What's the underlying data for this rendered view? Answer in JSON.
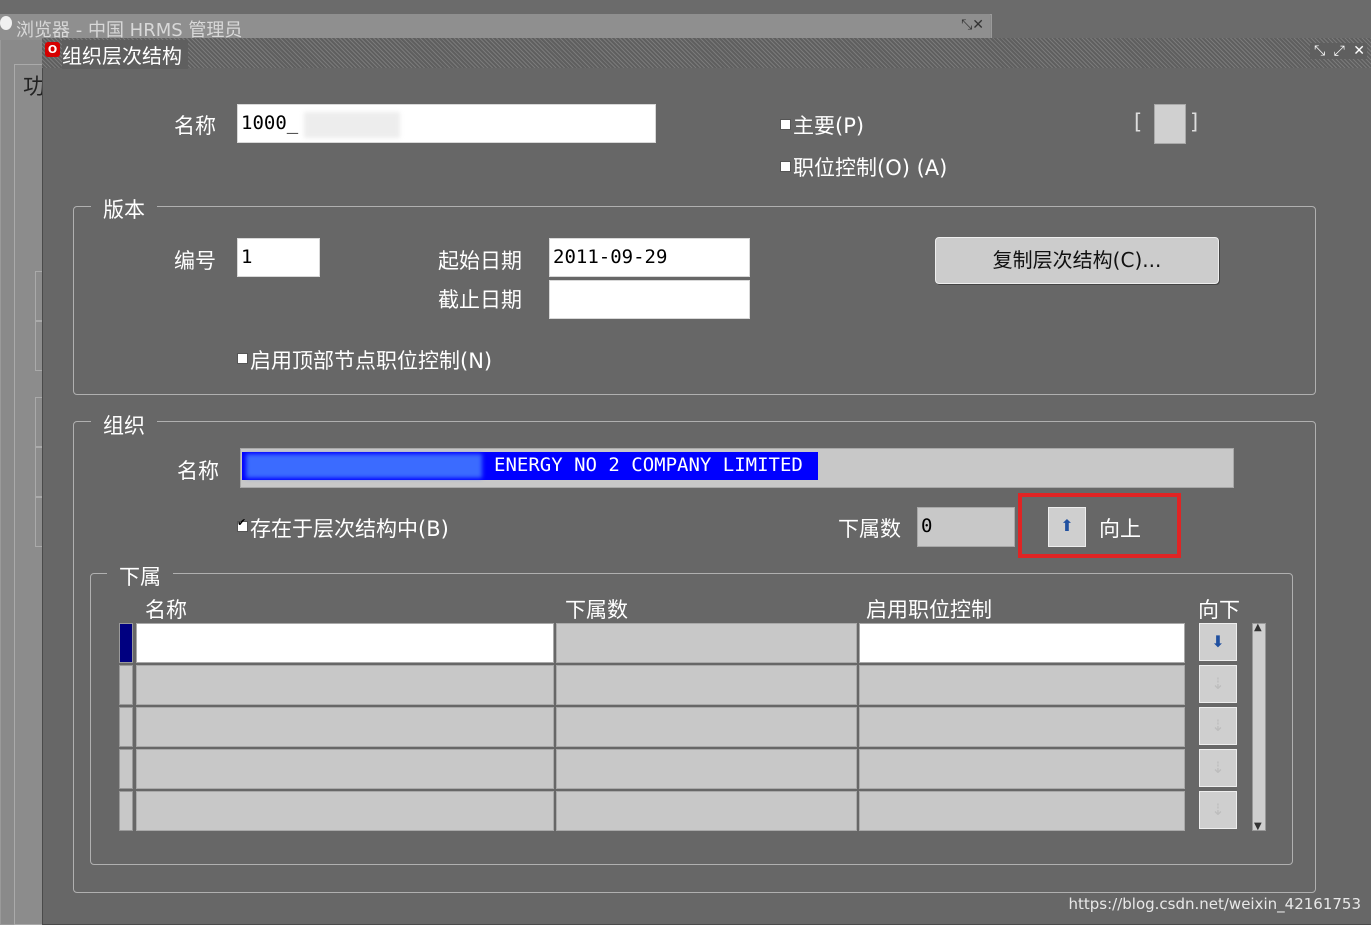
{
  "background_window": {
    "title": "浏览器 - 中国 HRMS 管理员",
    "side_label": "功"
  },
  "window": {
    "title": "组织层次结构",
    "controls": "⤡ ⤢ ✕"
  },
  "top": {
    "name_label": "名称",
    "name_value": "1000_",
    "primary_label": "主要(P)",
    "position_control_label": "职位控制(O) (A)",
    "bracket_left": "[",
    "bracket_right": "]"
  },
  "version": {
    "group_title": "版本",
    "number_label": "编号",
    "number_value": "1",
    "start_date_label": "起始日期",
    "start_date_value": "2011-09-29",
    "end_date_label": "截止日期",
    "end_date_value": "",
    "copy_button": "复制层次结构(C)...",
    "top_node_label": "启用顶部节点职位控制(N)"
  },
  "organization": {
    "group_title": "组织",
    "name_label": "名称",
    "name_value": "ENERGY NO 2 COMPANY LIMITED",
    "exists_label": "存在于层次结构中(B)",
    "exists_checked": true,
    "subordinate_count_label": "下属数",
    "subordinate_count_value": "0",
    "up_label": "向上"
  },
  "subordinates": {
    "group_title": "下属",
    "columns": [
      "名称",
      "下属数",
      "启用职位控制",
      "向下"
    ],
    "row_count": 5
  },
  "watermark": "https://blog.csdn.net/weixin_42161753",
  "colors": {
    "background": "#6b6b6b",
    "highlight": "#e02424",
    "selection": "#0000ff",
    "current_row": "#000080"
  }
}
